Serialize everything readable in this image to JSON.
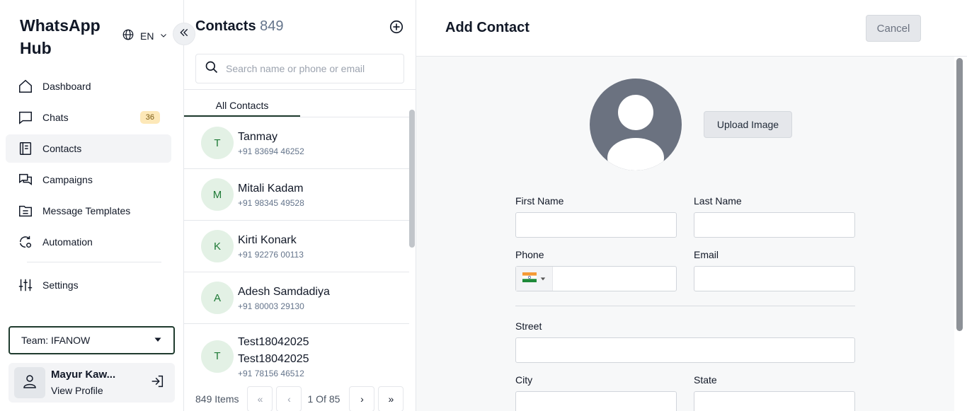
{
  "sidebar": {
    "brand_line1": "WhatsApp",
    "brand_line2": "Hub",
    "language": "EN",
    "nav": [
      {
        "label": "Dashboard",
        "icon": "home-icon"
      },
      {
        "label": "Chats",
        "icon": "chat-icon",
        "badge": "36"
      },
      {
        "label": "Contacts",
        "icon": "contacts-icon",
        "active": true
      },
      {
        "label": "Campaigns",
        "icon": "campaigns-icon"
      },
      {
        "label": "Message Templates",
        "icon": "templates-icon"
      },
      {
        "label": "Automation",
        "icon": "automation-icon"
      }
    ],
    "settings_label": "Settings",
    "team": "Team: IFANOW",
    "profile": {
      "name": "Mayur Kaw...",
      "link": "View Profile"
    }
  },
  "contacts": {
    "title": "Contacts",
    "count": "849",
    "search_placeholder": "Search name or phone or email",
    "tab": "All Contacts",
    "items": [
      {
        "initial": "T",
        "name": "Tanmay",
        "phone": "+91 83694 46252"
      },
      {
        "initial": "M",
        "name": "Mitali Kadam",
        "phone": "+91 98345 49528"
      },
      {
        "initial": "K",
        "name": "Kirti Konark",
        "phone": "+91 92276 00113"
      },
      {
        "initial": "A",
        "name": "Adesh Samdadiya",
        "phone": "+91 80003 29130"
      },
      {
        "initial": "T",
        "name": "Test18042025",
        "name2": "Test18042025",
        "phone": "+91 78156 46512"
      }
    ],
    "pager": {
      "items": "849 Items",
      "page": "1 Of 85",
      "first": "«",
      "prev": "‹",
      "next": "›",
      "last": "»"
    }
  },
  "form": {
    "title": "Add Contact",
    "cancel": "Cancel",
    "upload": "Upload Image",
    "labels": {
      "first_name": "First Name",
      "last_name": "Last Name",
      "phone": "Phone",
      "email": "Email",
      "street": "Street",
      "city": "City",
      "state": "State"
    },
    "phone_country": "IN"
  },
  "colors": {
    "accent": "#1f3b2e",
    "badge_bg": "#fde8b8",
    "avatar_bg": "#e3f1e5",
    "avatar_text": "#1e7a36"
  }
}
